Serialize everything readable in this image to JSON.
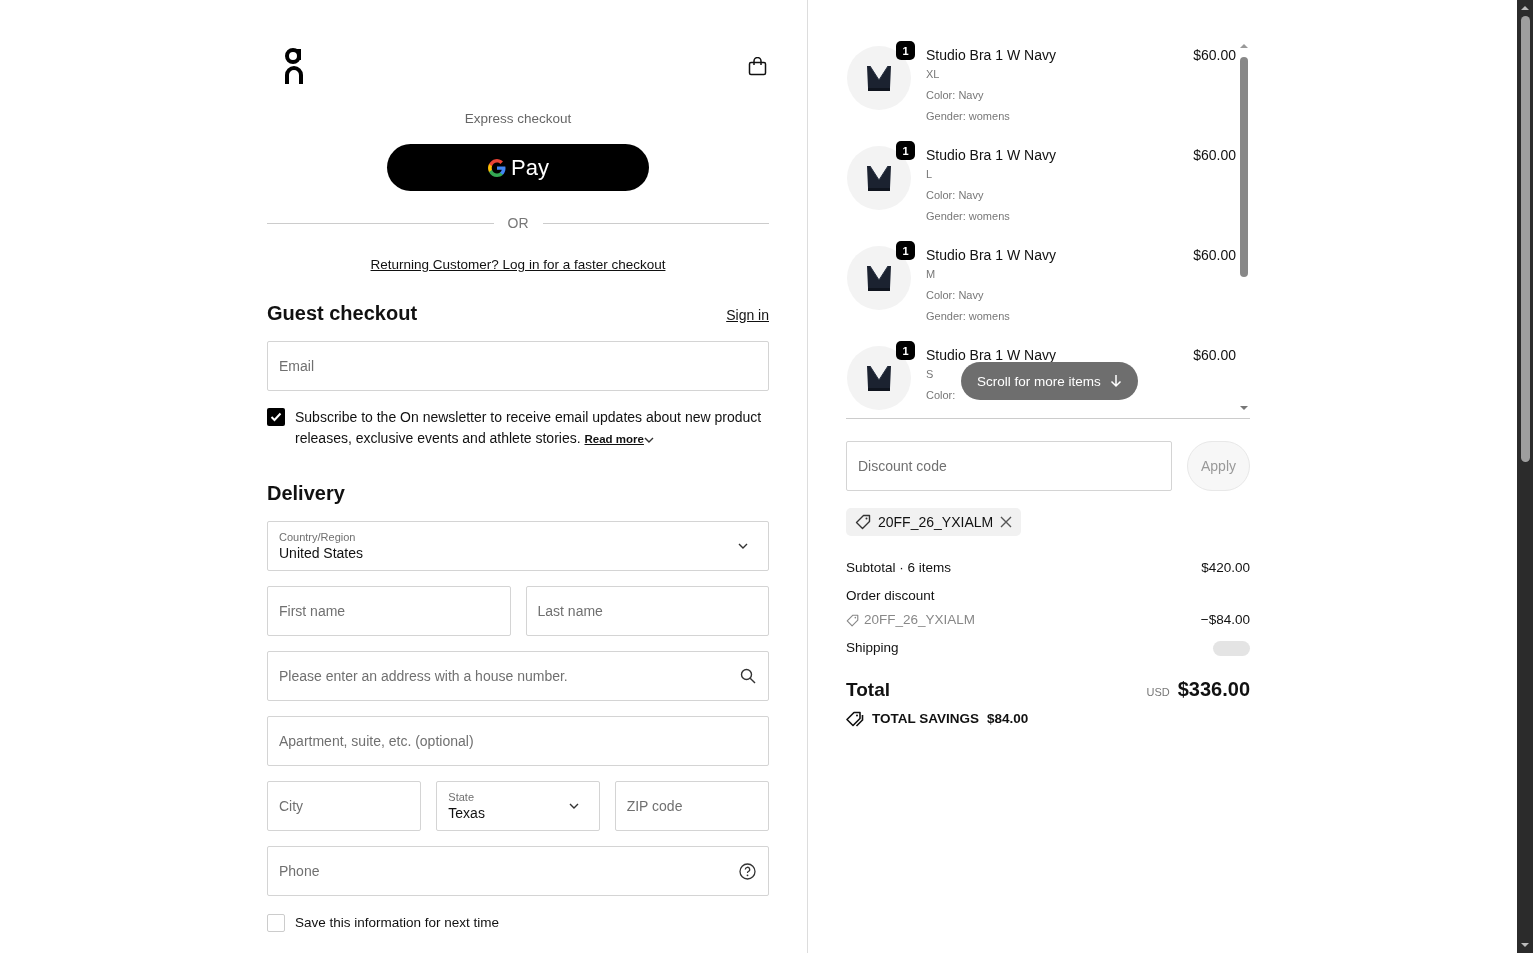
{
  "express_checkout": {
    "label": "Express checkout",
    "pay_button": "Pay"
  },
  "separator": "OR",
  "returning_link": "Returning Customer? Log in for a faster checkout",
  "guest": {
    "title": "Guest checkout",
    "sign_in": "Sign in"
  },
  "email": {
    "placeholder": "Email"
  },
  "newsletter": {
    "checked": true,
    "text": "Subscribe to the On newsletter to receive email updates about new product releases, exclusive events and athlete stories.",
    "link": "Read more"
  },
  "delivery": {
    "title": "Delivery",
    "rows": [
      [
        {
          "kind": "select",
          "label": "Country/Region",
          "value": "United States"
        }
      ],
      [
        {
          "kind": "text",
          "placeholder": "First name"
        },
        {
          "kind": "text",
          "placeholder": "Last name"
        }
      ],
      [
        {
          "kind": "search",
          "placeholder": "Please enter an address with a house number."
        }
      ],
      [
        {
          "kind": "text",
          "placeholder": "Apartment, suite, etc. (optional)"
        }
      ],
      [
        {
          "kind": "text",
          "placeholder": "City"
        },
        {
          "kind": "select",
          "label": "State",
          "value": "Texas"
        },
        {
          "kind": "text",
          "placeholder": "ZIP code"
        }
      ],
      [
        {
          "kind": "help",
          "placeholder": "Phone"
        }
      ]
    ]
  },
  "save_info": {
    "checked": false,
    "label": "Save this information for next time"
  },
  "summary": {
    "items": [
      {
        "quantity": "1",
        "name": "Studio Bra 1 W Navy",
        "price": "$60.00",
        "details": [
          "XL",
          "Color: Navy",
          "Gender: womens"
        ]
      },
      {
        "quantity": "1",
        "name": "Studio Bra 1 W Navy",
        "price": "$60.00",
        "details": [
          "L",
          "Color: Navy",
          "Gender: womens"
        ]
      },
      {
        "quantity": "1",
        "name": "Studio Bra 1 W Navy",
        "price": "$60.00",
        "details": [
          "M",
          "Color: Navy",
          "Gender: womens"
        ]
      },
      {
        "quantity": "1",
        "name": "Studio Bra 1 W Navy",
        "price": "$60.00",
        "details": [
          "S",
          "Color:"
        ]
      }
    ],
    "scroll_hint": "Scroll for more items",
    "discount": {
      "placeholder": "Discount code",
      "button": "Apply"
    },
    "applied_code": "20FF_26_YXIALM",
    "subtotal": {
      "label": "Subtotal · 6 items",
      "value": "$420.00"
    },
    "order_discount": {
      "label": "Order discount",
      "code": "20FF_26_YXIALM",
      "value": "−$84.00"
    },
    "shipping": {
      "label": "Shipping"
    },
    "total": {
      "label": "Total",
      "currency": "USD",
      "value": "$336.00"
    },
    "savings": {
      "label": "TOTAL SAVINGS",
      "value": "$84.00"
    }
  }
}
